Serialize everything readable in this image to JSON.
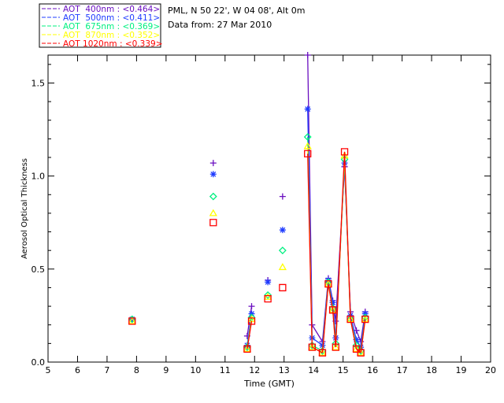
{
  "header": {
    "site": "PML, N 50 22', W 04 08', Alt 0m",
    "date": "Data from: 27 Mar 2010"
  },
  "chart_data": {
    "type": "line",
    "title": "",
    "xlabel": "Time (GMT)",
    "ylabel": "Aerosol Optical Thickness",
    "xlim": [
      5,
      20
    ],
    "ylim": [
      0,
      1.65
    ],
    "xticks": [
      "5",
      "6",
      "7",
      "8",
      "9",
      "10",
      "11",
      "12",
      "13",
      "14",
      "15",
      "16",
      "17",
      "18",
      "19",
      "20"
    ],
    "yticks": [
      "0.0",
      "0.5",
      "1.0",
      "1.5"
    ],
    "grid": false,
    "legend_position": "top-left",
    "x": [
      7.85,
      10.6,
      11.75,
      11.9,
      12.45,
      12.95,
      13.8,
      13.95,
      14.3,
      14.5,
      14.65,
      14.75,
      15.05,
      15.25,
      15.45,
      15.6,
      15.75
    ],
    "series": [
      {
        "name": "AOT  400nm : <0.464>",
        "color": "#6a0fc0",
        "marker": "plus",
        "values": [
          0.23,
          1.07,
          0.14,
          0.3,
          0.44,
          0.89,
          1.65,
          0.2,
          0.11,
          0.45,
          0.33,
          0.22,
          1.05,
          0.27,
          0.17,
          0.11,
          0.27
        ]
      },
      {
        "name": "AOT  500nm : <0.411>",
        "color": "#1f3cff",
        "marker": "asterisk",
        "values": [
          0.23,
          1.01,
          0.09,
          0.26,
          0.43,
          0.71,
          1.36,
          0.13,
          0.09,
          0.44,
          0.32,
          0.13,
          1.07,
          0.25,
          0.12,
          0.08,
          0.26
        ]
      },
      {
        "name": "AOT  675nm : <0.369>",
        "color": "#00f080",
        "marker": "diamond",
        "values": [
          0.23,
          0.89,
          0.08,
          0.24,
          0.36,
          0.6,
          1.21,
          0.09,
          0.06,
          0.43,
          0.29,
          0.1,
          1.09,
          0.23,
          0.09,
          0.06,
          0.24
        ]
      },
      {
        "name": "AOT  870nm : <0.352>",
        "color": "#ffff00",
        "marker": "triangle",
        "values": [
          0.22,
          0.8,
          0.07,
          0.23,
          0.35,
          0.51,
          1.16,
          0.08,
          0.05,
          0.42,
          0.28,
          0.08,
          1.11,
          0.23,
          0.07,
          0.05,
          0.23
        ]
      },
      {
        "name": "AOT 1020nm : <0.339>",
        "color": "#ff0000",
        "marker": "square",
        "values": [
          0.22,
          0.75,
          0.07,
          0.22,
          0.34,
          0.4,
          1.12,
          0.08,
          0.05,
          0.42,
          0.28,
          0.08,
          1.13,
          0.23,
          0.07,
          0.05,
          0.23
        ]
      }
    ]
  }
}
